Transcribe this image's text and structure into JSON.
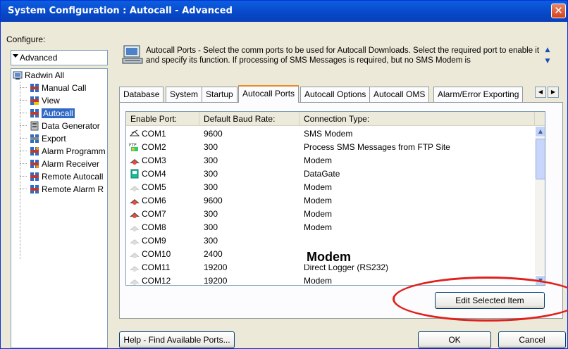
{
  "window": {
    "title": "System Configuration : Autocall - Advanced",
    "close_symbol": "✕"
  },
  "sidebar": {
    "configure_label": "Configure:",
    "configure_value": "Advanced",
    "tree": [
      {
        "label": "Radwin All",
        "icon": "radwin-root-icon"
      },
      {
        "label": "Manual Call",
        "icon": "manual-call-icon"
      },
      {
        "label": "View",
        "icon": "view-icon"
      },
      {
        "label": "Autocall",
        "icon": "autocall-icon",
        "selected": true
      },
      {
        "label": "Data Generator",
        "icon": "data-generator-icon"
      },
      {
        "label": "Export",
        "icon": "export-icon"
      },
      {
        "label": "Alarm Programm",
        "icon": "alarm-programmer-icon"
      },
      {
        "label": "Alarm Receiver",
        "icon": "alarm-receiver-icon"
      },
      {
        "label": "Remote Autocall",
        "icon": "remote-autocall-icon"
      },
      {
        "label": "Remote Alarm R",
        "icon": "remote-alarm-icon"
      }
    ]
  },
  "header": {
    "description": "Autocall Ports - Select the comm ports to be used for Autocall Downloads. Select the required port to enable it and specify its function. If processing of SMS Messages is required, but no SMS Modem is"
  },
  "tabs": [
    {
      "label": "Database"
    },
    {
      "label": "System"
    },
    {
      "label": "Startup"
    },
    {
      "label": "Autocall Ports",
      "active": true
    },
    {
      "label": "Autocall Options"
    },
    {
      "label": "Autocall OMS"
    },
    {
      "label": "Alarm/Error Exporting"
    }
  ],
  "list": {
    "columns": [
      "Enable Port:",
      "Default Baud Rate:",
      "Connection Type:"
    ],
    "rows": [
      {
        "port": "COM1",
        "baud": "9600",
        "type": "SMS Modem",
        "icon": "sms-modem-icon"
      },
      {
        "port": "COM2",
        "baud": "300",
        "type": "Process SMS Messages from FTP Site",
        "icon": "ftp-icon"
      },
      {
        "port": "COM3",
        "baud": "300",
        "type": "Modem",
        "icon": "modem-enabled-icon"
      },
      {
        "port": "COM4",
        "baud": "300",
        "type": "DataGate",
        "icon": "datagate-icon"
      },
      {
        "port": "COM5",
        "baud": "300",
        "type": "Modem",
        "icon": "modem-disabled-icon"
      },
      {
        "port": "COM6",
        "baud": "9600",
        "type": "Modem",
        "icon": "modem-enabled-icon"
      },
      {
        "port": "COM7",
        "baud": "300",
        "type": "Modem",
        "icon": "modem-enabled-icon"
      },
      {
        "port": "COM8",
        "baud": "300",
        "type": "Modem",
        "icon": "modem-disabled-icon"
      },
      {
        "port": "COM9",
        "baud": "300",
        "type": "",
        "icon": "modem-disabled-icon"
      },
      {
        "port": "COM10",
        "baud": "2400",
        "type": "",
        "icon": "modem-disabled-icon"
      },
      {
        "port": "COM11",
        "baud": "19200",
        "type": "Direct Logger (RS232)",
        "icon": "modem-disabled-icon"
      },
      {
        "port": "COM12",
        "baud": "19200",
        "type": "Modem",
        "icon": "modem-disabled-icon"
      }
    ],
    "overlay_label": "Modem"
  },
  "buttons": {
    "edit_selected": "Edit Selected Item",
    "help_find": "Help - Find Available Ports...",
    "ok": "OK",
    "cancel": "Cancel"
  },
  "colors": {
    "title_bar": "#0a4fd0",
    "selection": "#316ac5",
    "annotation_circle": "#e0201c",
    "active_tab_accent": "#e68b2c"
  }
}
